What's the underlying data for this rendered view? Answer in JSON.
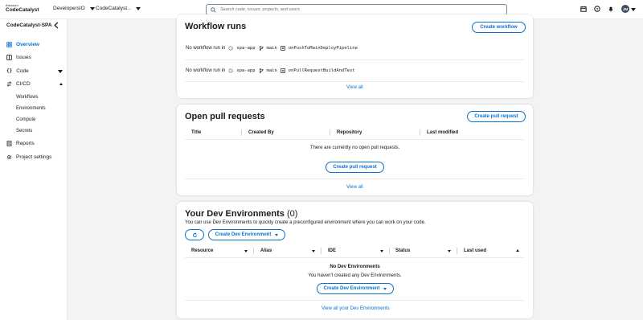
{
  "topbar": {
    "logo_line1": "Amazon",
    "logo_line2": "CodeCatalyst",
    "space": "DevelopersIO",
    "project": "CodeCatalyst...",
    "search_placeholder": "Search code, issues, projects, and users",
    "avatar_initials": "JM"
  },
  "sidebar": {
    "project_name": "CodeCatalyst-SPA",
    "items": [
      {
        "label": "Overview"
      },
      {
        "label": "Issues"
      },
      {
        "label": "Code"
      },
      {
        "label": "CI/CD"
      },
      {
        "label": "Reports"
      },
      {
        "label": "Project settings"
      }
    ],
    "cicd_sub": [
      "Workflows",
      "Environments",
      "Compute",
      "Secrets"
    ]
  },
  "workflow_runs": {
    "title": "Workflow runs",
    "create_button": "Create workflow",
    "rows": [
      {
        "prefix": "No workflow run in",
        "repo": "spa-app",
        "branch": "main",
        "workflow": "onPushToMainDeployPipeline"
      },
      {
        "prefix": "No workflow run in",
        "repo": "spa-app",
        "branch": "main",
        "workflow": "onPullRequestBuildAndTest"
      }
    ],
    "view_all": "View all"
  },
  "pull_requests": {
    "title": "Open pull requests",
    "create_button": "Create pull request",
    "columns": [
      "Title",
      "Created By",
      "Repository",
      "Last modified"
    ],
    "empty_text": "There are currently no open pull requests.",
    "empty_button": "Create pull request",
    "view_all": "View all"
  },
  "dev_envs": {
    "title": "Your Dev Environments",
    "count": "(0)",
    "description": "You can use Dev Environments to quickly create a preconfigured environment where you can work on your code.",
    "create_button": "Create Dev Environment",
    "columns": [
      "Resource",
      "Alias",
      "IDE",
      "Status",
      "Last used"
    ],
    "empty_title": "No Dev Environments",
    "empty_text": "You haven't created any Dev Environments.",
    "empty_button": "Create Dev Environment",
    "view_all": "View all your Dev Environments"
  },
  "colors": {
    "accent": "#0972d3",
    "text": "#16191f",
    "background": "#f2f3f3"
  }
}
